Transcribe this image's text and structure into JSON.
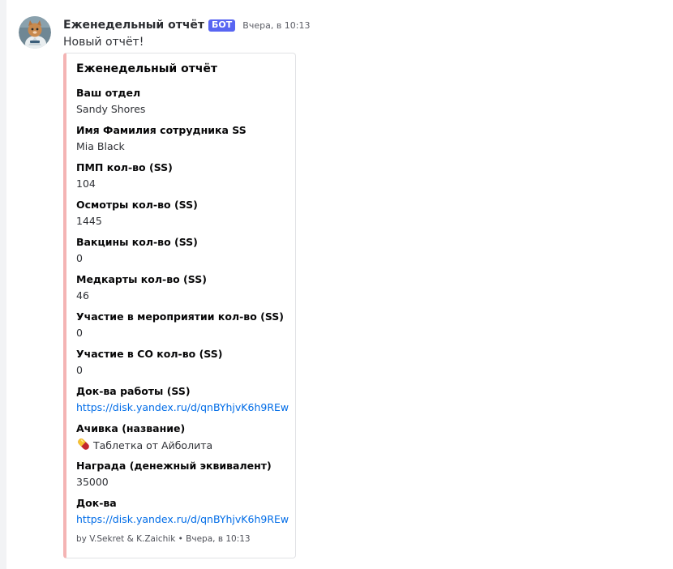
{
  "message": {
    "author": "Еженедельный отчёт",
    "bot_badge": "БОТ",
    "timestamp": "Вчера, в 10:13",
    "content": "Новый отчёт!"
  },
  "embed": {
    "accent_color": "#f4b4b4",
    "title": "Еженедельный отчёт",
    "fields": [
      {
        "name": "Ваш отдел",
        "value": "Sandy Shores"
      },
      {
        "name": "Имя Фамилия сотрудника SS",
        "value": "Mia Black"
      },
      {
        "name": "ПМП кол-во (SS)",
        "value": "104"
      },
      {
        "name": "Осмотры кол-во (SS)",
        "value": "1445"
      },
      {
        "name": "Вакцины кол-во (SS)",
        "value": "0"
      },
      {
        "name": "Медкарты кол-во (SS)",
        "value": "46"
      },
      {
        "name": "Участие в мероприятии кол-во (SS)",
        "value": "0"
      },
      {
        "name": "Участие в СО кол-во (SS)",
        "value": "0"
      },
      {
        "name": "Док-ва работы (SS)",
        "value": "https://disk.yandex.ru/d/qnBYhjvK6h9REw"
      },
      {
        "name": "Ачивка (название)",
        "value": "Таблетка от Айболита",
        "icon": "pill-emoji"
      },
      {
        "name": "Награда (денежный эквивалент)",
        "value": "35000"
      },
      {
        "name": "Док-ва",
        "value": "https://disk.yandex.ru/d/qnBYhjvK6h9REw"
      }
    ],
    "footer": "by V.Sekret & K.Zaichik • Вчера, в 10:13"
  },
  "colors": {
    "bot_badge": "#5865f2",
    "link": "#006ce7"
  }
}
